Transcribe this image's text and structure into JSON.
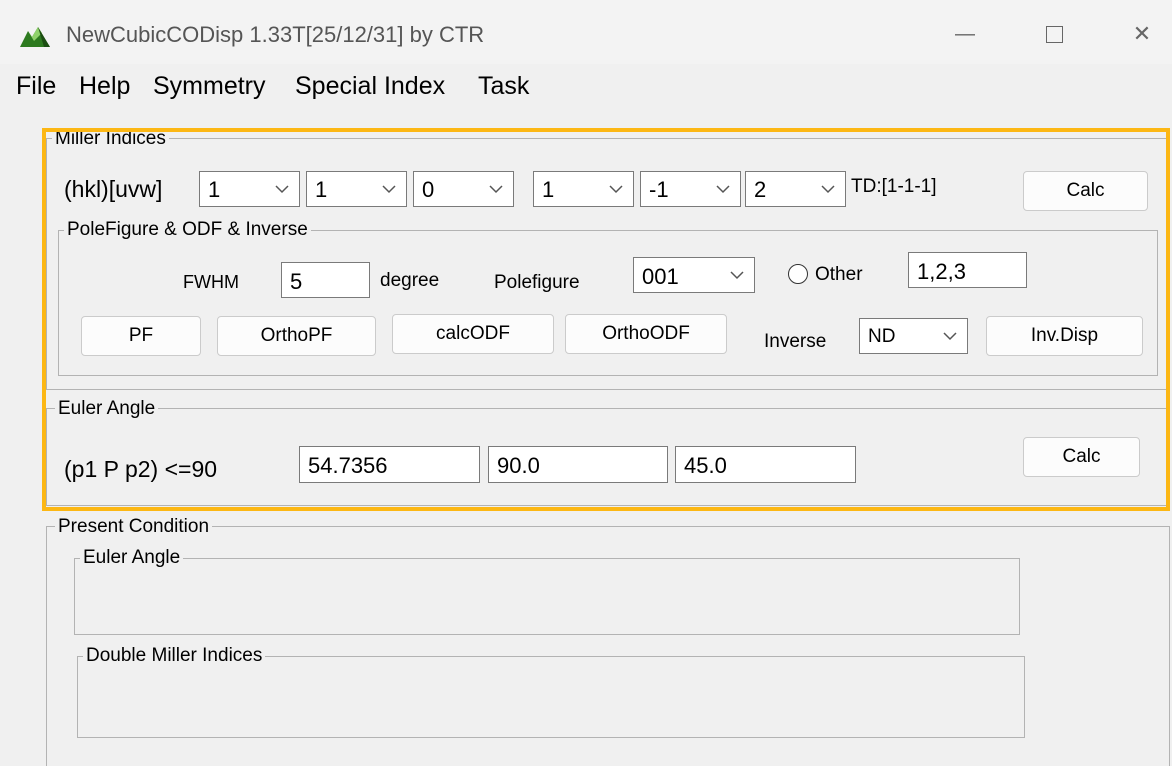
{
  "window": {
    "title": "NewCubicCODisp 1.33T[25/12/31] by CTR",
    "minimize_glyph": "—",
    "close_glyph": "✕",
    "accent_color": "#fcb714"
  },
  "menu": {
    "items": [
      "File",
      "Help",
      "Symmetry",
      "Special Index",
      "Task"
    ]
  },
  "miller": {
    "group_label": "Miller Indices",
    "row_label": "(hkl)[uvw]",
    "h": "1",
    "k": "1",
    "l": "0",
    "u": "1",
    "v": "-1",
    "w": "2",
    "td_label": "TD:[1-1-1]",
    "calc_label": "Calc"
  },
  "pole": {
    "group_label": "PoleFigure & ODF & Inverse",
    "fwhm_label": "FWHM",
    "fwhm_value": "5",
    "degree_label": "degree",
    "polefigure_label": "Polefigure",
    "polefigure_value": "001",
    "other_label": "Other",
    "other_value": "1,2,3",
    "pf_label": "PF",
    "orthopf_label": "OrthoPF",
    "calcodf_label": "calcODF",
    "orthoodf_label": "OrthoODF",
    "inverse_label": "Inverse",
    "inverse_value": "ND",
    "invdisp_label": "Inv.Disp"
  },
  "euler": {
    "group_label": "Euler Angle",
    "row_label": "(p1 P p2) <=90",
    "p1": "54.7356",
    "P": "90.0",
    "p2": "45.0",
    "calc_label": "Calc"
  },
  "present": {
    "group_label": "Present Condition",
    "euler_label": "Euler Angle",
    "double_miller_label": "Double Miller Indices"
  }
}
